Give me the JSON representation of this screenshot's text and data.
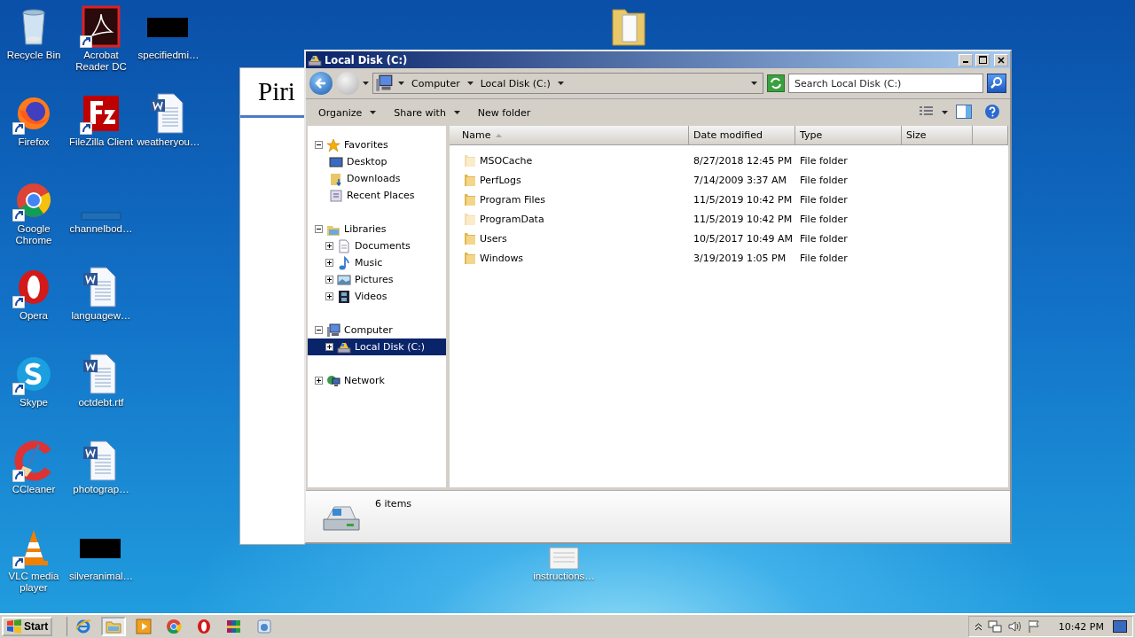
{
  "desktop_columns": [
    {
      "icons": [
        {
          "label": "Recycle Bin",
          "kind": "recycle"
        },
        {
          "label": "Firefox",
          "kind": "firefox"
        },
        {
          "label": "Google Chrome",
          "kind": "chrome"
        },
        {
          "label": "Opera",
          "kind": "opera"
        },
        {
          "label": "Skype",
          "kind": "skype"
        },
        {
          "label": "CCleaner",
          "kind": "ccleaner"
        },
        {
          "label": "VLC media player",
          "kind": "vlc"
        }
      ]
    },
    {
      "icons": [
        {
          "label": "Acrobat Reader DC",
          "kind": "acrobat"
        },
        {
          "label": "FileZilla Client",
          "kind": "filezilla"
        },
        {
          "label": "channelbod…",
          "kind": "blank"
        },
        {
          "label": "languagew…",
          "kind": "word"
        },
        {
          "label": "octdebt.rtf",
          "kind": "word"
        },
        {
          "label": "photograp…",
          "kind": "word"
        },
        {
          "label": "silveranimal…",
          "kind": "redacted"
        }
      ]
    },
    {
      "icons": [
        {
          "label": "specifiedmi…",
          "kind": "redacted"
        },
        {
          "label": "weatheryou…",
          "kind": "word"
        }
      ]
    }
  ],
  "loose_icon": {
    "label": "instructions…",
    "kind": "text"
  },
  "background_window": {
    "heading": "Piri"
  },
  "explorer": {
    "title": "Local Disk (C:)",
    "breadcrumb": [
      "Computer",
      "Local Disk (C:)"
    ],
    "search": {
      "placeholder": "Search Local Disk (C:)"
    },
    "toolbar": [
      {
        "label": "Organize",
        "dropdown": true
      },
      {
        "label": "Share with",
        "dropdown": true
      },
      {
        "label": "New folder",
        "dropdown": false
      }
    ],
    "nav": [
      {
        "label": "Favorites",
        "kind": "star",
        "expanded": true,
        "selected": false,
        "children": [
          {
            "label": "Desktop",
            "kind": "desktop",
            "selected": false
          },
          {
            "label": "Downloads",
            "kind": "downloads",
            "selected": false
          },
          {
            "label": "Recent Places",
            "kind": "recent",
            "selected": false
          }
        ]
      },
      {
        "label": "Libraries",
        "kind": "library",
        "expanded": true,
        "selected": false,
        "children": [
          {
            "label": "Documents",
            "kind": "documents",
            "expanded": false,
            "selected": false
          },
          {
            "label": "Music",
            "kind": "music",
            "expanded": false,
            "selected": false
          },
          {
            "label": "Pictures",
            "kind": "pictures",
            "expanded": false,
            "selected": false
          },
          {
            "label": "Videos",
            "kind": "videos",
            "expanded": false,
            "selected": false
          }
        ]
      },
      {
        "label": "Computer",
        "kind": "computer",
        "expanded": true,
        "selected": false,
        "children": [
          {
            "label": "Local Disk (C:)",
            "kind": "drive",
            "expanded": false,
            "selected": true
          }
        ]
      },
      {
        "label": "Network",
        "kind": "network",
        "expanded": false,
        "selected": false
      }
    ],
    "columns": [
      "Name",
      "Date modified",
      "Type",
      "Size"
    ],
    "rows": [
      {
        "name": "MSOCache",
        "date": "8/27/2018 12:45 PM",
        "type": "File folder",
        "hidden": true
      },
      {
        "name": "PerfLogs",
        "date": "7/14/2009 3:37 AM",
        "type": "File folder",
        "hidden": false
      },
      {
        "name": "Program Files",
        "date": "11/5/2019 10:42 PM",
        "type": "File folder",
        "hidden": false
      },
      {
        "name": "ProgramData",
        "date": "11/5/2019 10:42 PM",
        "type": "File folder",
        "hidden": true
      },
      {
        "name": "Users",
        "date": "10/5/2017 10:49 AM",
        "type": "File folder",
        "hidden": false
      },
      {
        "name": "Windows",
        "date": "3/19/2019 1:05 PM",
        "type": "File folder",
        "hidden": false
      }
    ],
    "status": "6 items"
  },
  "taskbar": {
    "start": "Start",
    "apps": [
      {
        "kind": "ie",
        "selected": false
      },
      {
        "kind": "explorer",
        "selected": true
      },
      {
        "kind": "media",
        "selected": false
      },
      {
        "kind": "chrome",
        "selected": false
      },
      {
        "kind": "opera",
        "selected": false
      },
      {
        "kind": "winrar",
        "selected": false
      },
      {
        "kind": "setup",
        "selected": false
      }
    ],
    "clock": "10:42 PM"
  }
}
